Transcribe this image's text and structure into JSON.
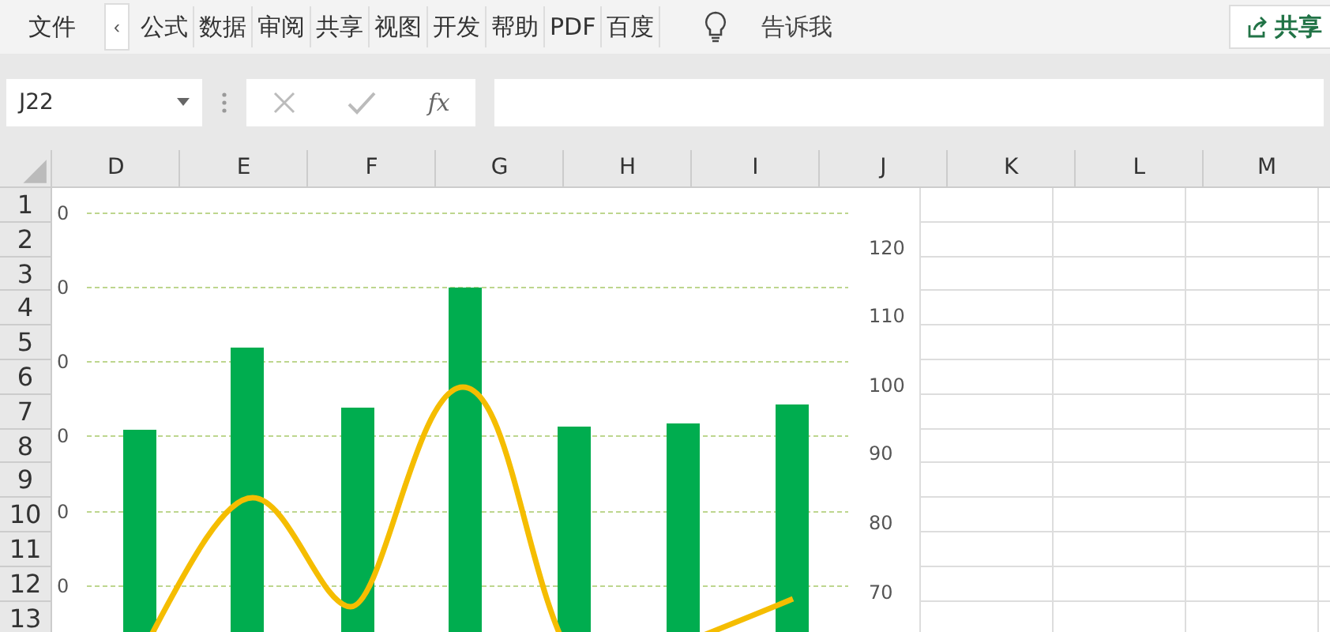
{
  "ribbon": {
    "file_tab": "文件",
    "scroll_button": "‹",
    "tabs": [
      {
        "label": "公式",
        "selected": false
      },
      {
        "label": "数据",
        "selected": false
      },
      {
        "label": "审阅",
        "selected": false
      },
      {
        "label": "共享",
        "selected": false
      },
      {
        "label": "视图",
        "selected": false
      },
      {
        "label": "开发",
        "selected": false
      },
      {
        "label": "帮助",
        "selected": false
      },
      {
        "label": "PDF",
        "selected": false
      },
      {
        "label": "百度",
        "selected": false
      }
    ],
    "tell_me": "告诉我",
    "share": "共享"
  },
  "formula_bar": {
    "name_box": "J22",
    "fx": "fx"
  },
  "sheet": {
    "columns": [
      "D",
      "E",
      "F",
      "G",
      "H",
      "I",
      "J",
      "K",
      "L",
      "M"
    ],
    "rows": [
      "1",
      "2",
      "3",
      "4",
      "5",
      "6",
      "7",
      "8",
      "9",
      "10",
      "11",
      "12",
      "13"
    ],
    "chart": {
      "left_axis_labels": [
        "0",
        "0",
        "0",
        "0",
        "0",
        "0"
      ],
      "right_axis_labels": [
        "120",
        "110",
        "100",
        "90",
        "80",
        "70"
      ]
    }
  }
}
